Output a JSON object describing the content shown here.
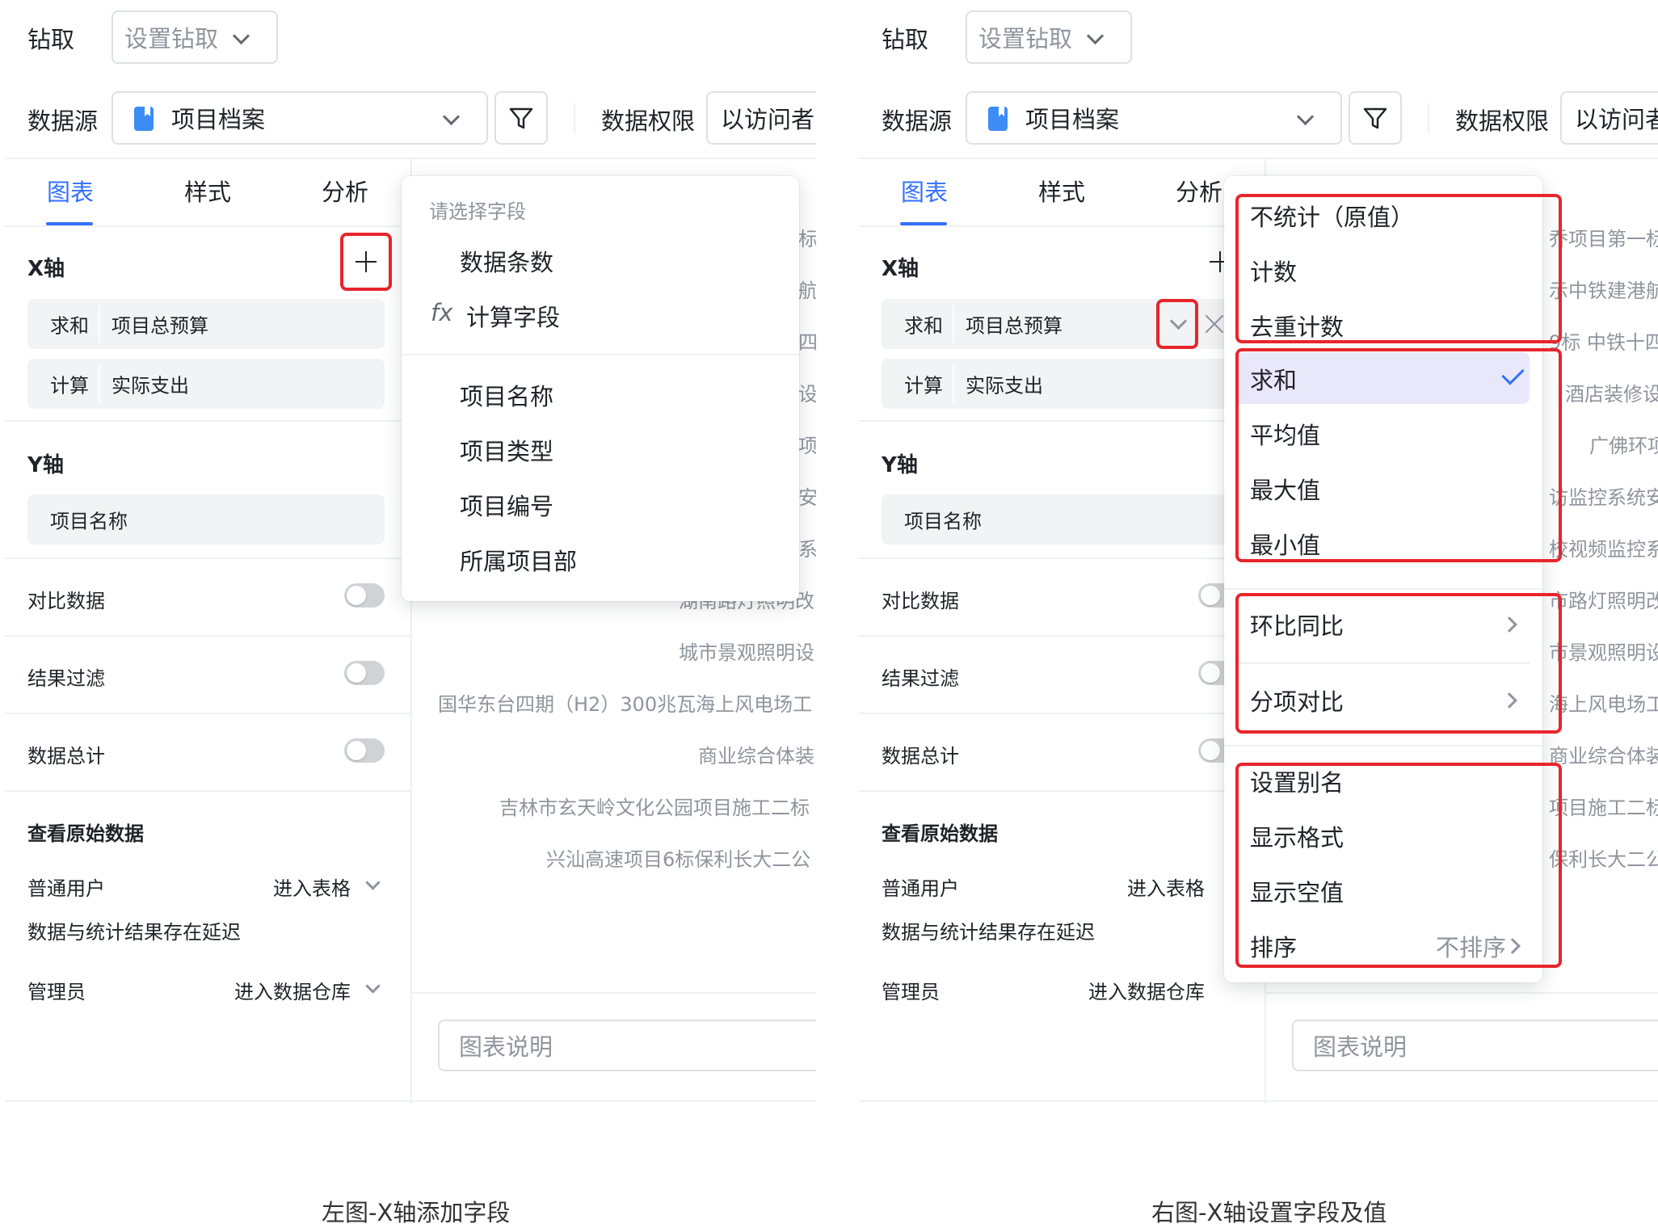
{
  "top": {
    "drill_label": "钻取",
    "drill_placeholder": "设置钻取",
    "datasource_label": "数据源",
    "datasource_value": "项目档案",
    "permission_label": "数据权限",
    "permission_value": "以访问者"
  },
  "tabs": [
    "图表",
    "样式",
    "分析"
  ],
  "x_axis": {
    "label": "X轴",
    "fields": [
      {
        "agg": "求和",
        "name": "项目总预算"
      },
      {
        "agg": "计算",
        "name": "实际支出"
      }
    ]
  },
  "y_axis": {
    "label": "Y轴",
    "fields": [
      {
        "name": "项目名称"
      }
    ]
  },
  "toggles": {
    "compare": "对比数据",
    "filter": "结果过滤",
    "total": "数据总计"
  },
  "raw_data": {
    "title": "查看原始数据",
    "normal_user": "普通用户",
    "normal_action": "进入表格",
    "delay_note": "数据与统计结果存在延迟",
    "admin": "管理员",
    "admin_action": "进入数据仓库"
  },
  "field_picker": {
    "title": "请选择字段",
    "special": [
      "数据条数",
      "计算字段"
    ],
    "fx_symbol": "fx",
    "fields": [
      "项目名称",
      "项目类型",
      "项目编号",
      "所属项目部"
    ]
  },
  "left_preview": {
    "peek": [
      "标",
      "航",
      "四",
      "设",
      "项",
      "安",
      "系"
    ],
    "partial": "湖南路灯照明改",
    "rows": [
      "城市景观照明设",
      "国华东台四期（H2）300兆瓦海上风电场工",
      "商业综合体装",
      "吉林市玄天岭文化公园项目施工二标",
      "兴汕高速项目6标保利长大二公"
    ]
  },
  "right_preview": {
    "rows": [
      "乔项目第一标",
      "示中铁建港航",
      "9标 中铁十四",
      "酒店装修设",
      "广佛环项",
      "访监控系统安",
      "校视频监控系",
      "市路灯照明改",
      "市景观照明设",
      "海上风电场工",
      "商业综合体装",
      "项目施工二标",
      "保利长大二公"
    ]
  },
  "chart_desc_placeholder": "图表说明",
  "agg_menu": {
    "group1": [
      "不统计（原值）",
      "计数",
      "去重计数"
    ],
    "group2": [
      "求和",
      "平均值",
      "最大值",
      "最小值"
    ],
    "selected": "求和",
    "group3": [
      "环比同比",
      "分项对比"
    ],
    "group4": [
      "设置别名",
      "显示格式",
      "显示空值",
      "排序"
    ],
    "sort_value": "不排序"
  },
  "captions": {
    "left": "左图-X轴添加字段",
    "right": "右图-X轴设置字段及值"
  },
  "colors": {
    "accent": "#3370ff",
    "highlight": "#e8252c",
    "selected_bg": "#e9e8fb"
  }
}
